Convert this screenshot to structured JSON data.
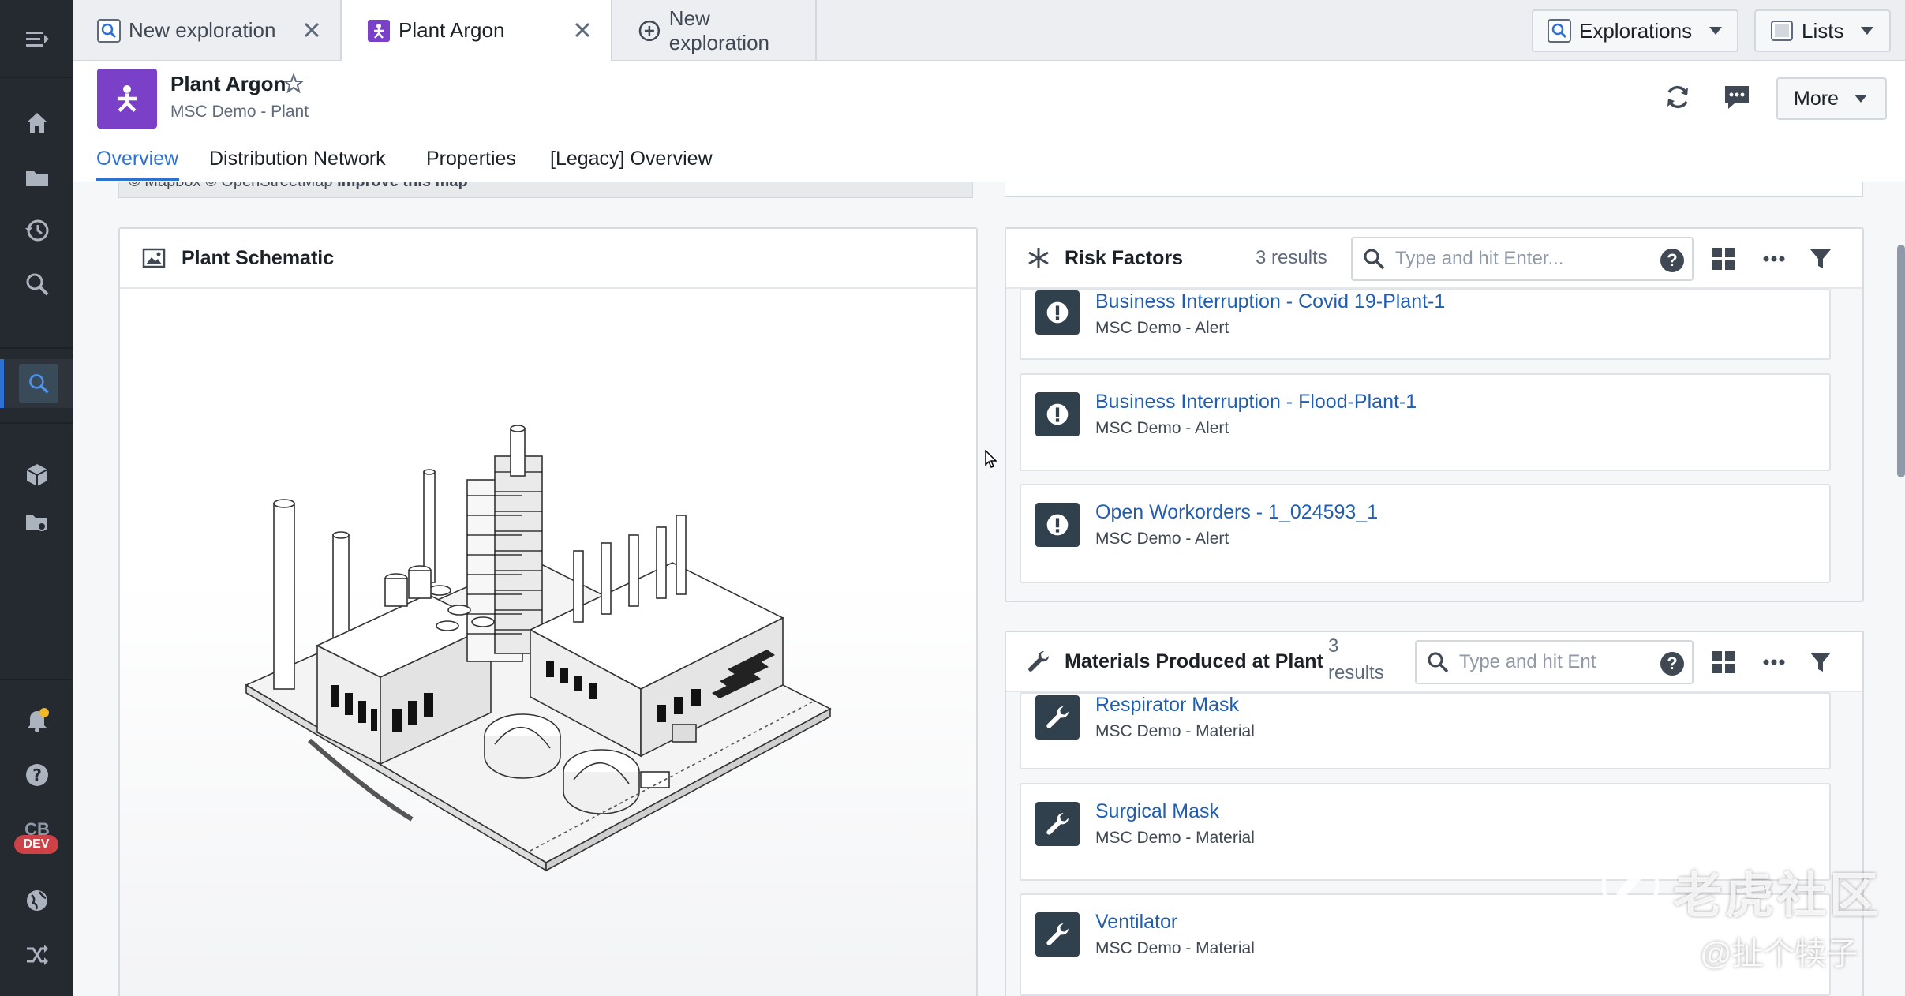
{
  "tabs": [
    {
      "label": "New exploration",
      "icon": "search-icon",
      "closable": true
    },
    {
      "label": "Plant Argon",
      "icon": "plant-object-icon",
      "closable": true,
      "active": true
    },
    {
      "label": "New exploration",
      "icon": "plus-circle-icon",
      "closable": false
    }
  ],
  "toolbar": {
    "explorations_label": "Explorations",
    "lists_label": "Lists"
  },
  "object": {
    "title": "Plant Argon",
    "subtitle": "MSC Demo - Plant",
    "more_label": "More",
    "accent": "#7a40c8"
  },
  "subtabs": [
    "Overview",
    "Distribution Network",
    "Properties",
    "[Legacy] Overview"
  ],
  "map": {
    "attribution": "© Mapbox © OpenStreetMap",
    "improve": "Improve this map"
  },
  "schematic": {
    "title": "Plant Schematic"
  },
  "risk_factors": {
    "title": "Risk Factors",
    "count": "3 results",
    "placeholder": "Type and hit Enter...",
    "items": [
      {
        "title": "Business Interruption - Covid 19-Plant-1",
        "subtitle": "MSC Demo - Alert"
      },
      {
        "title": "Business Interruption - Flood-Plant-1",
        "subtitle": "MSC Demo - Alert"
      },
      {
        "title": "Open Workorders - 1_024593_1",
        "subtitle": "MSC Demo - Alert"
      }
    ]
  },
  "materials": {
    "title": "Materials Produced at Plant",
    "count_num": "3",
    "count_word": "results",
    "placeholder": "Type and hit Ent",
    "items": [
      {
        "title": "Respirator Mask",
        "subtitle": "MSC Demo - Material"
      },
      {
        "title": "Surgical Mask",
        "subtitle": "MSC Demo - Material"
      },
      {
        "title": "Ventilator",
        "subtitle": "MSC Demo - Material"
      }
    ]
  },
  "sidebar": {
    "cb_label": "CB",
    "dev_label": "DEV"
  },
  "watermark": {
    "title": "老虎社区",
    "handle": "@扯个犊子"
  }
}
